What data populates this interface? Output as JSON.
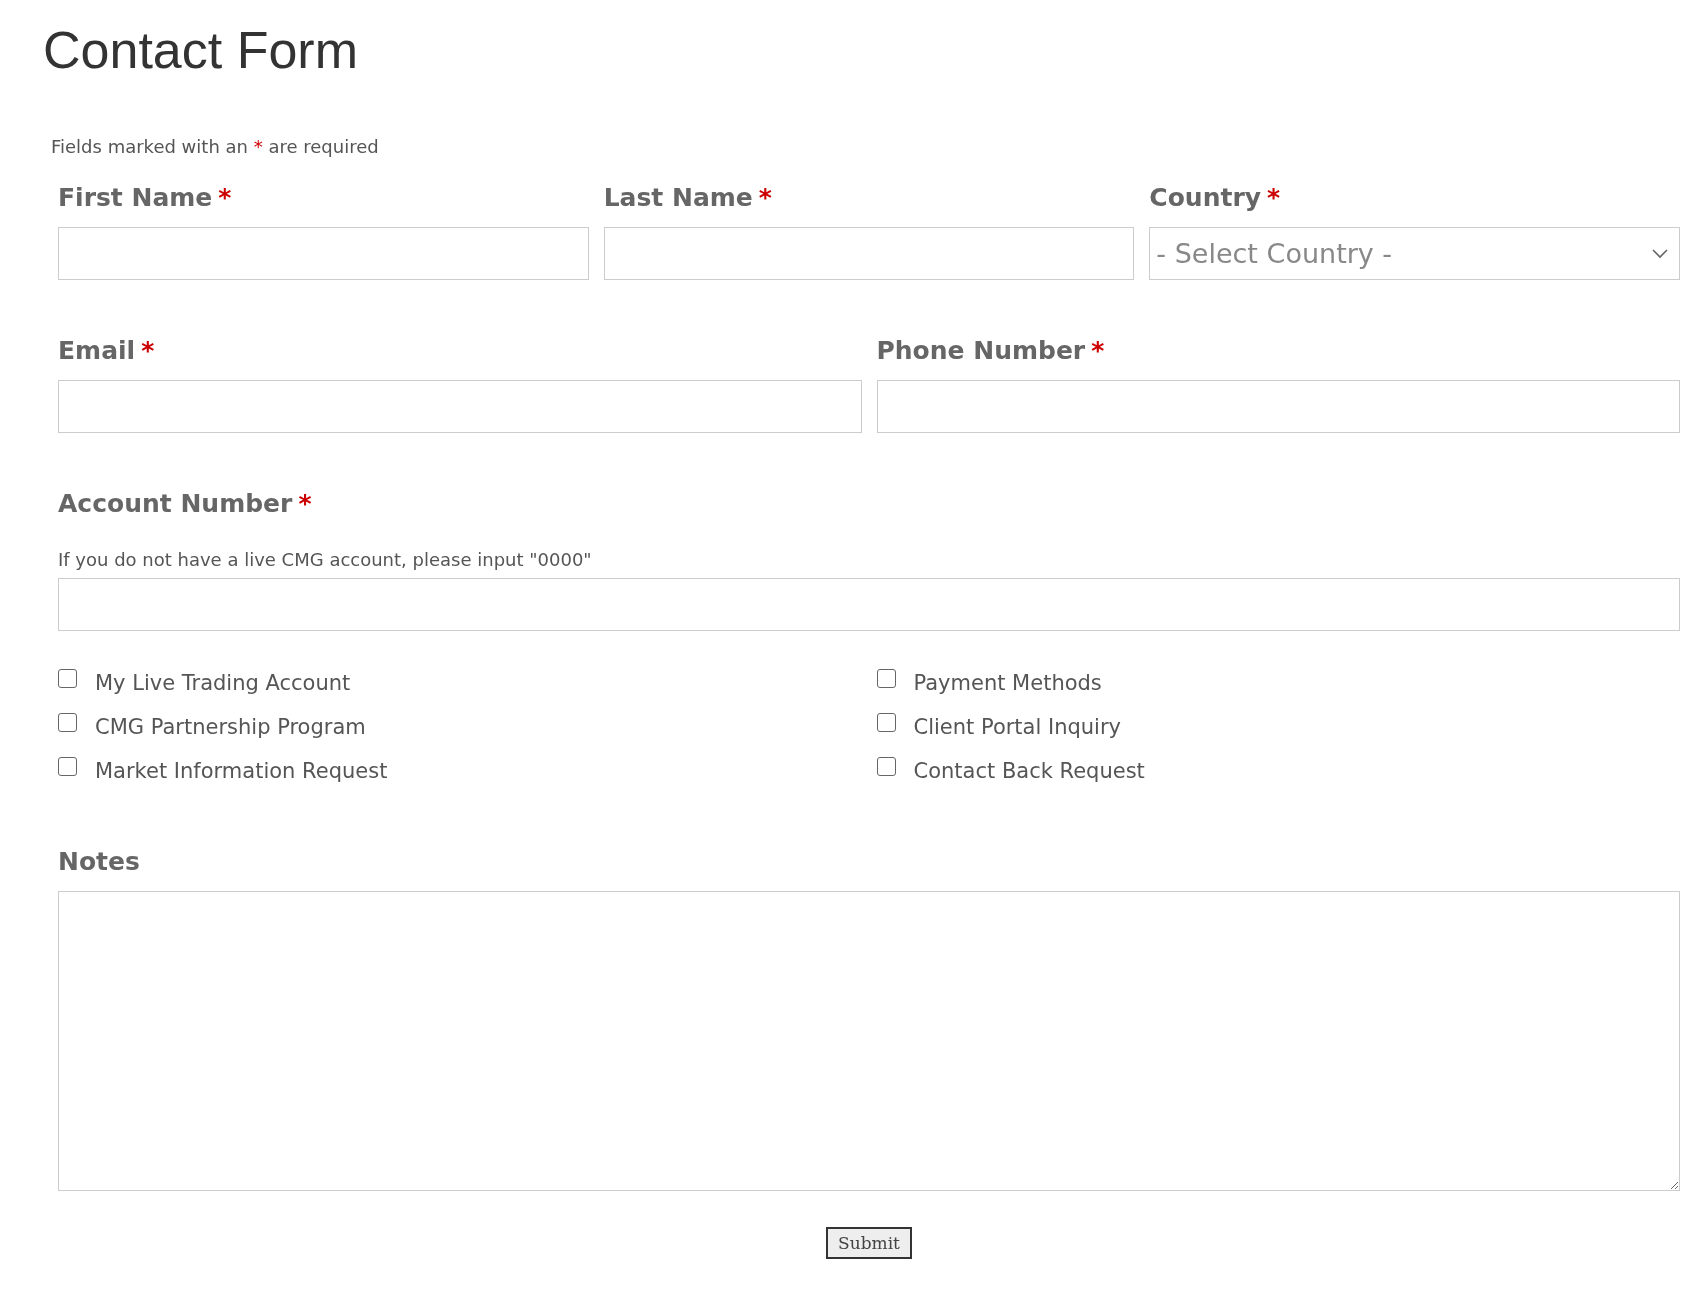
{
  "title": "Contact Form",
  "required_note": {
    "before": "Fields marked with an",
    "mark": "*",
    "after": "are required"
  },
  "rows": [
    {
      "fields": [
        {
          "label": "First Name",
          "required": true,
          "kind": "text"
        },
        {
          "label": "Last Name",
          "required": true,
          "kind": "text"
        },
        {
          "label": "Country",
          "required": true,
          "kind": "select",
          "placeholder": "- Select Country -"
        }
      ]
    },
    {
      "fields": [
        {
          "label": "Email",
          "required": true,
          "kind": "text"
        },
        {
          "label": "Phone Number",
          "required": true,
          "kind": "text"
        }
      ]
    },
    {
      "fields": [
        {
          "label": "Account Number",
          "required": true,
          "kind": "text",
          "hint": "If you do not have a live CMG account, please input \"0000\""
        }
      ]
    }
  ],
  "topics": [
    {
      "label": "My Live Trading Account",
      "checked": false
    },
    {
      "label": "Payment Methods",
      "checked": false
    },
    {
      "label": "CMG Partnership Program",
      "checked": false
    },
    {
      "label": "Client Portal Inquiry",
      "checked": false
    },
    {
      "label": "Market Information Request",
      "checked": false
    },
    {
      "label": "Contact Back Request",
      "checked": false
    }
  ],
  "notes": {
    "label": "Notes"
  },
  "submit": "Submit"
}
